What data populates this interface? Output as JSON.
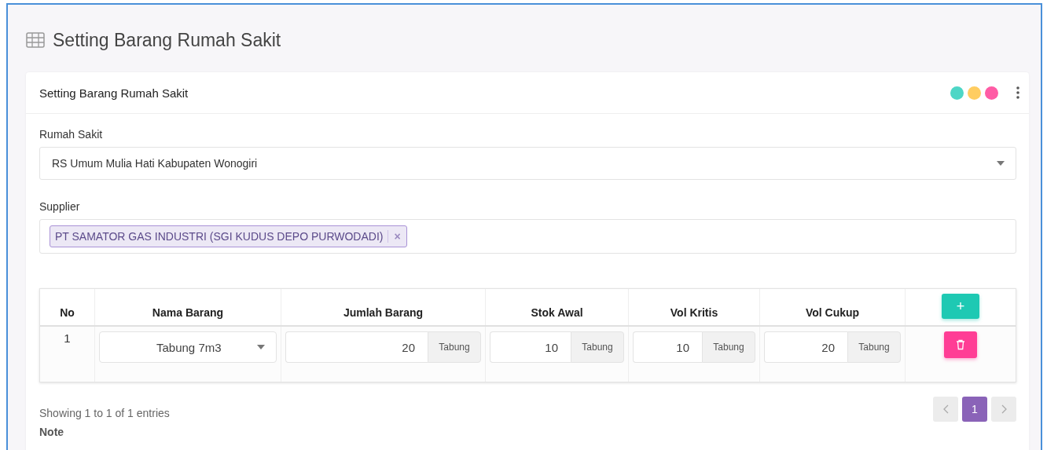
{
  "page_title": "Setting Barang Rumah Sakit",
  "card": {
    "title": "Setting Barang Rumah Sakit",
    "dots": [
      {
        "color": "#4dd6c6"
      },
      {
        "color": "#ffcd61"
      },
      {
        "color": "#ff5ca5"
      }
    ],
    "hospital": {
      "label": "Rumah Sakit",
      "value": "RS Umum Mulia Hati Kabupaten Wonogiri"
    },
    "supplier": {
      "label": "Supplier",
      "tags": [
        "PT SAMATOR GAS INDUSTRI (SGI KUDUS DEPO PURWODADI)"
      ],
      "remove": "×"
    },
    "table": {
      "columns": [
        "No",
        "Nama Barang",
        "Jumlah Barang",
        "Stok Awal",
        "Vol Kritis",
        "Vol Cukup"
      ],
      "add_button": "+",
      "rows": [
        {
          "no": "1",
          "item": "Tabung 7m3",
          "amounts": [
            {
              "value": "20",
              "unit": "Tabung"
            },
            {
              "value": "10",
              "unit": "Tabung"
            },
            {
              "value": "10",
              "unit": "Tabung"
            },
            {
              "value": "20",
              "unit": "Tabung"
            }
          ]
        }
      ]
    },
    "info": "Showing 1 to 1 of 1 entries",
    "pages": [
      {
        "label": "1",
        "selected": true
      }
    ],
    "note_label": "Note"
  }
}
